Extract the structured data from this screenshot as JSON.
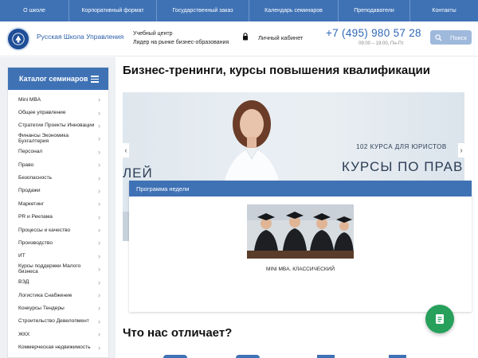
{
  "topnav": {
    "items": [
      {
        "label": "О школе"
      },
      {
        "label": "Корпоративный формат"
      },
      {
        "label": "Государственный заказ"
      },
      {
        "label": "Календарь семинаров"
      },
      {
        "label": "Преподаватели"
      },
      {
        "label": "Контакты"
      }
    ]
  },
  "header": {
    "logo_text": "Русская Школа Управления",
    "center_line1": "Учебный центр",
    "center_line2": "Лидер на рынке бизнес-образования",
    "cabinet_label": "Личный кабинет",
    "phone": "+7 (495) 980 57 28",
    "hours": "09:00 – 19:00, Пн-Пт",
    "search_label": "Поиск"
  },
  "catalog": {
    "title": "Каталог семинаров",
    "items": [
      {
        "label": "Mini MBA"
      },
      {
        "label": "Общее управление"
      },
      {
        "label": "Стратегии Проекты Инновации"
      },
      {
        "label": "Финансы Экономика Бухгалтерия"
      },
      {
        "label": "Персонал"
      },
      {
        "label": "Право"
      },
      {
        "label": "Безопасность"
      },
      {
        "label": "Продажи"
      },
      {
        "label": "Маркетинг"
      },
      {
        "label": "PR и Реклама"
      },
      {
        "label": "Процессы и качество"
      },
      {
        "label": "Производство"
      },
      {
        "label": "ИТ"
      },
      {
        "label": "Курсы поддержки Малого бизнеса"
      },
      {
        "label": "ВЭД"
      },
      {
        "label": "Логистика Снабжение"
      },
      {
        "label": "Конкурсы Тендеры"
      },
      {
        "label": "Строительство Девелопмент"
      },
      {
        "label": "ЖКХ"
      },
      {
        "label": "Коммерческая недвижимость"
      }
    ]
  },
  "main": {
    "title": "Бизнес-тренинги, курсы повышения квалификации",
    "banner": {
      "left_text": "ЛЕЙ",
      "sub_text": "102 КУРСА ДЛЯ ЮРИСТОВ",
      "big_text": "КУРСЫ ПО ПРАВ"
    },
    "week": {
      "title": "Программа недели",
      "caption": "MINI MBA. КЛАССИЧЕСКИЙ"
    },
    "section_title": "Что нас отличает?"
  },
  "colors": {
    "brand_blue": "#3f72b5",
    "fab_green": "#27a05b"
  },
  "icons": {
    "logo": "school-emblem-icon",
    "lock": "lock-icon",
    "search": "search-icon",
    "menu": "burger-menu-icon",
    "chevron": "chevron-right-icon",
    "fab": "document-icon"
  }
}
